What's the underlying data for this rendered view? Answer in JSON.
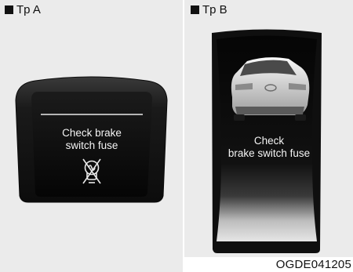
{
  "type_a": {
    "label": "Tp A",
    "message_line1": "Check brake",
    "message_line2": "switch fuse",
    "icon": "brake-switch-fuse-warning-icon"
  },
  "type_b": {
    "label": "Tp B",
    "message_line1": "Check",
    "message_line2": "brake switch fuse",
    "image": "car-rear-view-image"
  },
  "figure_code": "OGDE041205",
  "colors": {
    "panel_background": "#ebebeb",
    "display_bezel": "#161616",
    "display_text": "#f4f4f4"
  }
}
